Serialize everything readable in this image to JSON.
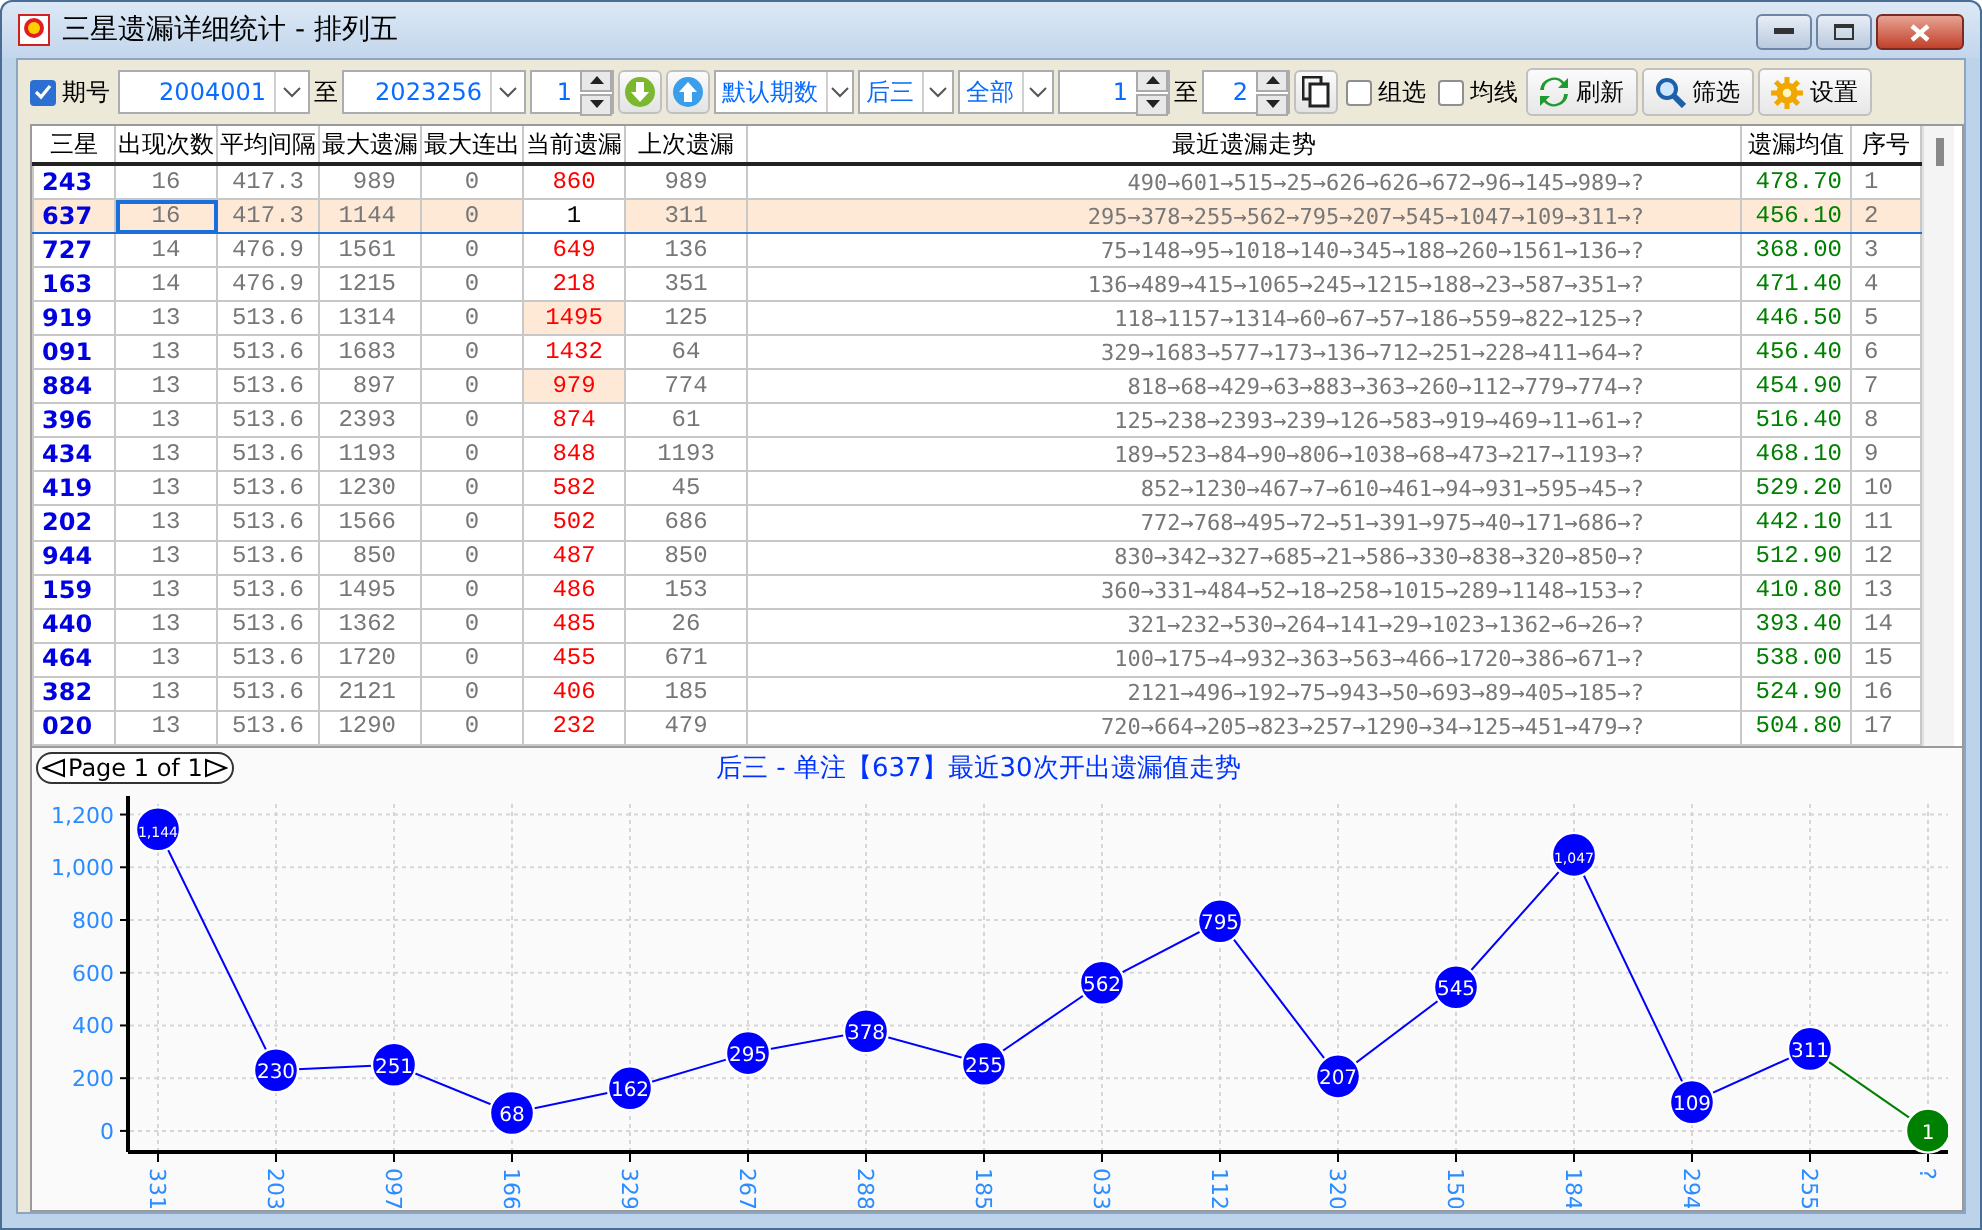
{
  "window": {
    "title": "三星遗漏详细统计 - 排列五"
  },
  "toolbar": {
    "period_checkbox": {
      "label": "期号",
      "checked": true
    },
    "from": "2004001",
    "to_label": "至",
    "to": "2023256",
    "step": "1",
    "mode": "默认期数",
    "position": "后三",
    "filter": "全部",
    "range_from": "1",
    "range_to_label": "至",
    "range_to": "2",
    "options": [
      {
        "label": "组选",
        "checked": false
      },
      {
        "label": "均线",
        "checked": false
      }
    ],
    "buttons": [
      {
        "label": "刷新",
        "kind": "refresh"
      },
      {
        "label": "筛选",
        "kind": "filter"
      },
      {
        "label": "设置",
        "kind": "settings"
      }
    ]
  },
  "table": {
    "columns": [
      "三星",
      "出现次数",
      "平均间隔",
      "最大遗漏",
      "最大连出",
      "当前遗漏",
      "上次遗漏",
      "最近遗漏走势",
      "遗漏均值",
      "序号"
    ],
    "rows": [
      {
        "number": "243",
        "count": "16",
        "avg_interval": "417.3",
        "max_miss": "989",
        "max_streak": "0",
        "current_miss": "860",
        "current_highlighted": false,
        "last_miss": "989",
        "trend": "490→601→515→25→626→626→672→96→145→989→?",
        "miss_average": "478.70",
        "index": "1",
        "selected": false
      },
      {
        "number": "637",
        "count": "16",
        "avg_interval": "417.3",
        "max_miss": "1144",
        "max_streak": "0",
        "current_miss": "1",
        "current_highlighted": false,
        "last_miss": "311",
        "trend": "295→378→255→562→795→207→545→1047→109→311→?",
        "miss_average": "456.10",
        "index": "2",
        "selected": true
      },
      {
        "number": "727",
        "count": "14",
        "avg_interval": "476.9",
        "max_miss": "1561",
        "max_streak": "0",
        "current_miss": "649",
        "current_highlighted": false,
        "last_miss": "136",
        "trend": "75→148→95→1018→140→345→188→260→1561→136→?",
        "miss_average": "368.00",
        "index": "3",
        "selected": false
      },
      {
        "number": "163",
        "count": "14",
        "avg_interval": "476.9",
        "max_miss": "1215",
        "max_streak": "0",
        "current_miss": "218",
        "current_highlighted": false,
        "last_miss": "351",
        "trend": "136→489→415→1065→245→1215→188→23→587→351→?",
        "miss_average": "471.40",
        "index": "4",
        "selected": false
      },
      {
        "number": "919",
        "count": "13",
        "avg_interval": "513.6",
        "max_miss": "1314",
        "max_streak": "0",
        "current_miss": "1495",
        "current_highlighted": true,
        "last_miss": "125",
        "trend": "118→1157→1314→60→67→57→186→559→822→125→?",
        "miss_average": "446.50",
        "index": "5",
        "selected": false
      },
      {
        "number": "091",
        "count": "13",
        "avg_interval": "513.6",
        "max_miss": "1683",
        "max_streak": "0",
        "current_miss": "1432",
        "current_highlighted": false,
        "last_miss": "64",
        "trend": "329→1683→577→173→136→712→251→228→411→64→?",
        "miss_average": "456.40",
        "index": "6",
        "selected": false
      },
      {
        "number": "884",
        "count": "13",
        "avg_interval": "513.6",
        "max_miss": "897",
        "max_streak": "0",
        "current_miss": "979",
        "current_highlighted": true,
        "last_miss": "774",
        "trend": "818→68→429→63→883→363→260→112→779→774→?",
        "miss_average": "454.90",
        "index": "7",
        "selected": false
      },
      {
        "number": "396",
        "count": "13",
        "avg_interval": "513.6",
        "max_miss": "2393",
        "max_streak": "0",
        "current_miss": "874",
        "current_highlighted": false,
        "last_miss": "61",
        "trend": "125→238→2393→239→126→583→919→469→11→61→?",
        "miss_average": "516.40",
        "index": "8",
        "selected": false
      },
      {
        "number": "434",
        "count": "13",
        "avg_interval": "513.6",
        "max_miss": "1193",
        "max_streak": "0",
        "current_miss": "848",
        "current_highlighted": false,
        "last_miss": "1193",
        "trend": "189→523→84→90→806→1038→68→473→217→1193→?",
        "miss_average": "468.10",
        "index": "9",
        "selected": false
      },
      {
        "number": "419",
        "count": "13",
        "avg_interval": "513.6",
        "max_miss": "1230",
        "max_streak": "0",
        "current_miss": "582",
        "current_highlighted": false,
        "last_miss": "45",
        "trend": "852→1230→467→7→610→461→94→931→595→45→?",
        "miss_average": "529.20",
        "index": "10",
        "selected": false
      },
      {
        "number": "202",
        "count": "13",
        "avg_interval": "513.6",
        "max_miss": "1566",
        "max_streak": "0",
        "current_miss": "502",
        "current_highlighted": false,
        "last_miss": "686",
        "trend": "772→768→495→72→51→391→975→40→171→686→?",
        "miss_average": "442.10",
        "index": "11",
        "selected": false
      },
      {
        "number": "944",
        "count": "13",
        "avg_interval": "513.6",
        "max_miss": "850",
        "max_streak": "0",
        "current_miss": "487",
        "current_highlighted": false,
        "last_miss": "850",
        "trend": "830→342→327→685→21→586→330→838→320→850→?",
        "miss_average": "512.90",
        "index": "12",
        "selected": false
      },
      {
        "number": "159",
        "count": "13",
        "avg_interval": "513.6",
        "max_miss": "1495",
        "max_streak": "0",
        "current_miss": "486",
        "current_highlighted": false,
        "last_miss": "153",
        "trend": "360→331→484→52→18→258→1015→289→1148→153→?",
        "miss_average": "410.80",
        "index": "13",
        "selected": false
      },
      {
        "number": "440",
        "count": "13",
        "avg_interval": "513.6",
        "max_miss": "1362",
        "max_streak": "0",
        "current_miss": "485",
        "current_highlighted": false,
        "last_miss": "26",
        "trend": "321→232→530→264→141→29→1023→1362→6→26→?",
        "miss_average": "393.40",
        "index": "14",
        "selected": false
      },
      {
        "number": "464",
        "count": "13",
        "avg_interval": "513.6",
        "max_miss": "1720",
        "max_streak": "0",
        "current_miss": "455",
        "current_highlighted": false,
        "last_miss": "671",
        "trend": "100→175→4→932→363→563→466→1720→386→671→?",
        "miss_average": "538.00",
        "index": "15",
        "selected": false
      },
      {
        "number": "382",
        "count": "13",
        "avg_interval": "513.6",
        "max_miss": "2121",
        "max_streak": "0",
        "current_miss": "406",
        "current_highlighted": false,
        "last_miss": "185",
        "trend": "2121→496→192→75→943→50→693→89→405→185→?",
        "miss_average": "524.90",
        "index": "16",
        "selected": false
      },
      {
        "number": "020",
        "count": "13",
        "avg_interval": "513.6",
        "max_miss": "1290",
        "max_streak": "0",
        "current_miss": "232",
        "current_highlighted": false,
        "last_miss": "479",
        "trend": "720→664→205→823→257→1290→34→125→451→479→?",
        "miss_average": "504.80",
        "index": "17",
        "selected": false
      }
    ]
  },
  "chart_panel": {
    "pager": "Page 1 of 1",
    "title": "后三 - 单注【637】最近30次开出遗漏值走势",
    "chart_data": {
      "type": "line",
      "categories": [
        "331",
        "203",
        "097",
        "166",
        "329",
        "267",
        "288",
        "185",
        "033",
        "112",
        "320",
        "150",
        "184",
        "294",
        "255",
        "?"
      ],
      "series": [
        {
          "color": "#0000ff",
          "marker": "circle",
          "values": [
            1144,
            230,
            251,
            68,
            162,
            295,
            378,
            255,
            562,
            795,
            207,
            545,
            1047,
            109,
            311,
            null
          ]
        },
        {
          "color": "#008000",
          "marker": "circle",
          "values": [
            null,
            null,
            null,
            null,
            null,
            null,
            null,
            null,
            null,
            null,
            null,
            null,
            null,
            null,
            311,
            1
          ]
        }
      ],
      "value_labels": [
        [
          "1,144",
          "230",
          "251",
          "68",
          "162",
          "295",
          "378",
          "255",
          "562",
          "795",
          "207",
          "545",
          "1,047",
          "109",
          "311",
          null
        ],
        [
          null,
          null,
          null,
          null,
          null,
          null,
          null,
          null,
          null,
          null,
          null,
          null,
          null,
          null,
          null,
          "1"
        ]
      ],
      "grid": true,
      "ylim": [
        -80,
        1240
      ],
      "yticks": [
        0,
        {
          "value": 200,
          "label": "200"
        },
        {
          "value": 400,
          "label": "400"
        },
        {
          "value": 600,
          "label": "600"
        },
        {
          "value": 800,
          "label": "800"
        },
        {
          "value": 1000,
          "label": "1,000"
        },
        {
          "value": 1200,
          "label": "1,200"
        }
      ]
    }
  }
}
